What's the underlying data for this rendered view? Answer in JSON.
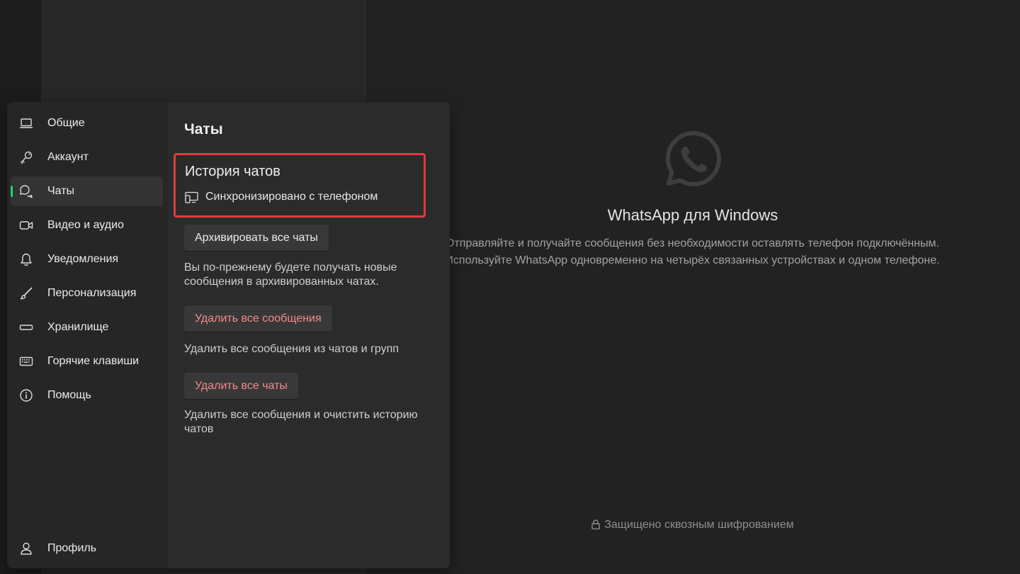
{
  "main": {
    "title": "WhatsApp для Windows",
    "desc_line1": "Отправляйте и получайте сообщения без необходимости оставлять телефон подключённым.",
    "desc_line2": "Используйте WhatsApp одновременно на четырёх связанных устройствах и одном телефоне.",
    "encryption_note": "Защищено сквозным шифрованием",
    "accent_color": "#25d366"
  },
  "settings": {
    "nav": {
      "general": "Общие",
      "account": "Аккаунт",
      "chats": "Чаты",
      "video_audio": "Видео и аудио",
      "notifications": "Уведомления",
      "personalization": "Персонализация",
      "storage": "Хранилище",
      "hotkeys": "Горячие клавиши",
      "help": "Помощь",
      "profile": "Профиль"
    },
    "active_item": "chats",
    "panel": {
      "title": "Чаты",
      "history_title": "История чатов",
      "sync_status": "Синхронизировано с телефоном",
      "archive_button": "Архивировать все чаты",
      "archive_help": "Вы по-прежнему будете получать новые сообщения в архивированных чатах.",
      "delete_messages_button": "Удалить все сообщения",
      "delete_messages_help": "Удалить все сообщения из чатов и групп",
      "delete_chats_button": "Удалить все чаты",
      "delete_chats_help": "Удалить все сообщения и очистить историю чатов"
    }
  }
}
